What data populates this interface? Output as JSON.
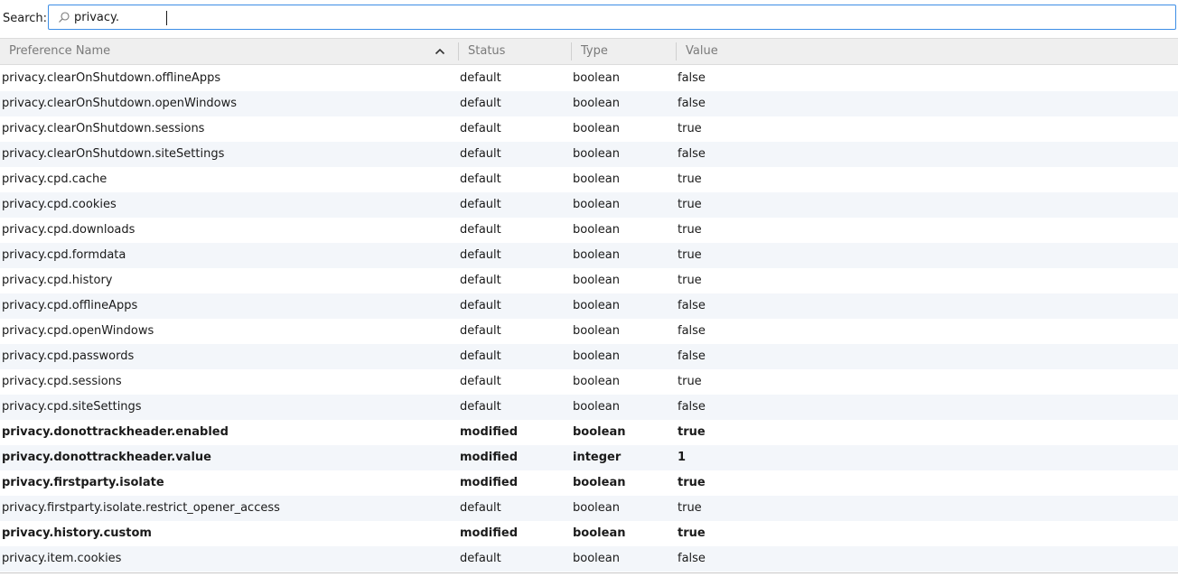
{
  "search": {
    "label": "Search:",
    "value": "privacy."
  },
  "columns": {
    "name": "Preference Name",
    "status": "Status",
    "type": "Type",
    "value": "Value"
  },
  "sort_icon": "chevron-up-icon",
  "rows": [
    {
      "name": "privacy.clearOnShutdown.offlineApps",
      "status": "default",
      "type": "boolean",
      "value": "false",
      "modified": false
    },
    {
      "name": "privacy.clearOnShutdown.openWindows",
      "status": "default",
      "type": "boolean",
      "value": "false",
      "modified": false
    },
    {
      "name": "privacy.clearOnShutdown.sessions",
      "status": "default",
      "type": "boolean",
      "value": "true",
      "modified": false
    },
    {
      "name": "privacy.clearOnShutdown.siteSettings",
      "status": "default",
      "type": "boolean",
      "value": "false",
      "modified": false
    },
    {
      "name": "privacy.cpd.cache",
      "status": "default",
      "type": "boolean",
      "value": "true",
      "modified": false
    },
    {
      "name": "privacy.cpd.cookies",
      "status": "default",
      "type": "boolean",
      "value": "true",
      "modified": false
    },
    {
      "name": "privacy.cpd.downloads",
      "status": "default",
      "type": "boolean",
      "value": "true",
      "modified": false
    },
    {
      "name": "privacy.cpd.formdata",
      "status": "default",
      "type": "boolean",
      "value": "true",
      "modified": false
    },
    {
      "name": "privacy.cpd.history",
      "status": "default",
      "type": "boolean",
      "value": "true",
      "modified": false
    },
    {
      "name": "privacy.cpd.offlineApps",
      "status": "default",
      "type": "boolean",
      "value": "false",
      "modified": false
    },
    {
      "name": "privacy.cpd.openWindows",
      "status": "default",
      "type": "boolean",
      "value": "false",
      "modified": false
    },
    {
      "name": "privacy.cpd.passwords",
      "status": "default",
      "type": "boolean",
      "value": "false",
      "modified": false
    },
    {
      "name": "privacy.cpd.sessions",
      "status": "default",
      "type": "boolean",
      "value": "true",
      "modified": false
    },
    {
      "name": "privacy.cpd.siteSettings",
      "status": "default",
      "type": "boolean",
      "value": "false",
      "modified": false
    },
    {
      "name": "privacy.donottrackheader.enabled",
      "status": "modified",
      "type": "boolean",
      "value": "true",
      "modified": true
    },
    {
      "name": "privacy.donottrackheader.value",
      "status": "modified",
      "type": "integer",
      "value": "1",
      "modified": true
    },
    {
      "name": "privacy.firstparty.isolate",
      "status": "modified",
      "type": "boolean",
      "value": "true",
      "modified": true
    },
    {
      "name": "privacy.firstparty.isolate.restrict_opener_access",
      "status": "default",
      "type": "boolean",
      "value": "true",
      "modified": false
    },
    {
      "name": "privacy.history.custom",
      "status": "modified",
      "type": "boolean",
      "value": "true",
      "modified": true
    },
    {
      "name": "privacy.item.cookies",
      "status": "default",
      "type": "boolean",
      "value": "false",
      "modified": false
    }
  ]
}
